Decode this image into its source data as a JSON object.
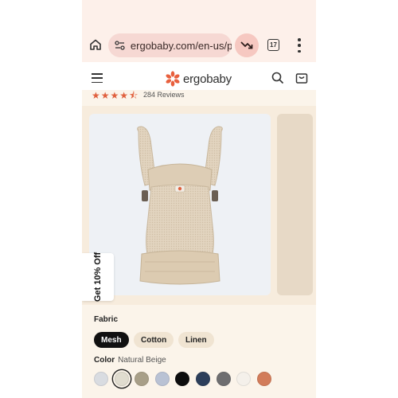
{
  "browser": {
    "url": "ergobaby.com/en-us/prc",
    "tab_count": "17"
  },
  "site": {
    "logo_text": "ergobaby"
  },
  "reviews": {
    "rating": 4.5,
    "count_text": "284 Reviews"
  },
  "gallery": {
    "discount_tab": "Get 10% Off"
  },
  "fabric": {
    "label": "Fabric",
    "options": [
      "Mesh",
      "Cotton",
      "Linen"
    ],
    "selected": "Mesh"
  },
  "color": {
    "label": "Color",
    "selected_name": "Natural Beige",
    "swatches": [
      "#d9dce1",
      "#e0dccf",
      "#a89f88",
      "#b9c2d4",
      "#0d0d0d",
      "#2c3e5a",
      "#6e6e70",
      "#f4f0ea",
      "#d27c5a"
    ],
    "selected_index": 1
  },
  "colors": {
    "accent": "#e0603e",
    "chrome_bg": "#fdf0ea",
    "page_bg": "#fbf4ea"
  }
}
